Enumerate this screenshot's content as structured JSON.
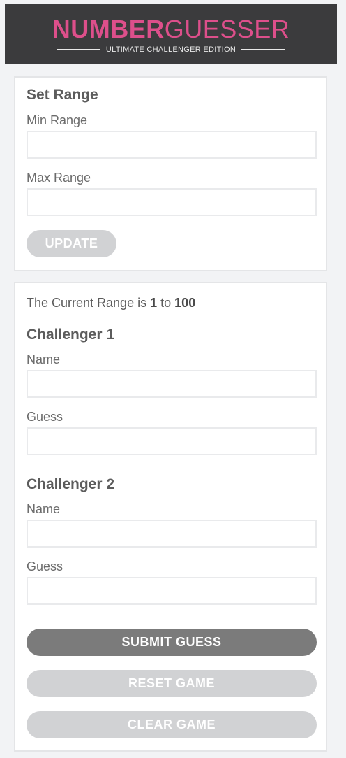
{
  "header": {
    "brand_strong": "NUMBER",
    "brand_light": "GUESSER",
    "edition": "ULTIMATE CHALLENGER EDITION"
  },
  "range_panel": {
    "title": "Set Range",
    "min_label": "Min Range",
    "min_value": "",
    "max_label": "Max Range",
    "max_value": "",
    "update_label": "UPDATE"
  },
  "game_panel": {
    "range_prefix": "The Current Range is",
    "range_min": "1",
    "range_joiner": "to",
    "range_max": "100",
    "challenger1": {
      "title": "Challenger 1",
      "name_label": "Name",
      "name_value": "",
      "guess_label": "Guess",
      "guess_value": ""
    },
    "challenger2": {
      "title": "Challenger 2",
      "name_label": "Name",
      "name_value": "",
      "guess_label": "Guess",
      "guess_value": ""
    },
    "submit_label": "SUBMIT GUESS",
    "reset_label": "RESET GAME",
    "clear_label": "CLEAR GAME"
  },
  "colors": {
    "brand": "#dd4f8b",
    "header_bg": "#3b3b3d",
    "page_bg": "#f2f3f5",
    "button_active": "#7b7b7b",
    "button_disabled": "#d1d2d4"
  }
}
